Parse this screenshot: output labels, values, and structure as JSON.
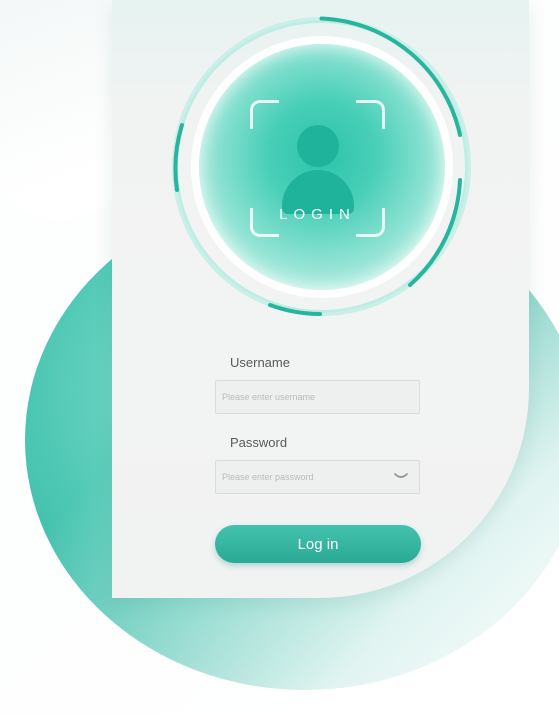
{
  "brand": {
    "accent": "#2fb39f",
    "accent_dark": "#1fb39b",
    "card_bg": "#f2f3f3"
  },
  "avatar": {
    "icon": "user-icon",
    "caption": "LOGIN"
  },
  "form": {
    "username": {
      "label": "Username",
      "value": "",
      "placeholder": "Please enter username"
    },
    "password": {
      "label": "Password",
      "value": "",
      "placeholder": "Please enter password",
      "toggle_icon": "eye-closed-icon"
    },
    "submit_label": "Log in"
  }
}
